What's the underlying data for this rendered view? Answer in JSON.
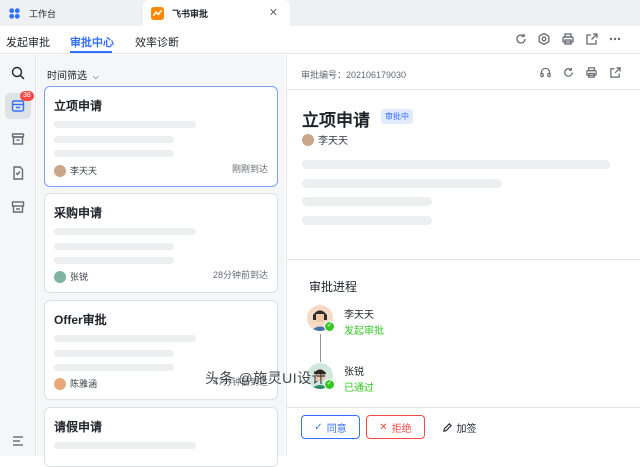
{
  "tabs": {
    "workspace": "工作台",
    "approval": "飞书审批"
  },
  "nav": {
    "items": [
      "发起审批",
      "审批中心",
      "效率诊断"
    ]
  },
  "sidebar": {
    "badge": "38"
  },
  "list": {
    "filter": "时间筛选",
    "cards": [
      {
        "title": "立项申请",
        "user": "李天天",
        "time": "刚刚到达"
      },
      {
        "title": "采购申请",
        "user": "张锐",
        "time": "28分钟前到达"
      },
      {
        "title": "Offer审批",
        "user": "陈雅涵",
        "time": "47分钟前到达"
      },
      {
        "title": "请假申请"
      }
    ]
  },
  "detail": {
    "number": "审批编号：202106179030",
    "title": "立项申请",
    "status": "审批中",
    "user": "李天天",
    "process_title": "审批进程",
    "steps": [
      {
        "name": "李天天",
        "status": "发起审批"
      },
      {
        "name": "张锐",
        "status": "已通过"
      }
    ],
    "actions": {
      "approve": "同意",
      "reject": "拒绝",
      "add_sign": "加签"
    }
  },
  "watermark": "头条 @施灵UI设计",
  "colors": {
    "accent": "#3370ff",
    "success": "#34c724",
    "danger": "#f54a45",
    "badge": "#f54a45"
  }
}
